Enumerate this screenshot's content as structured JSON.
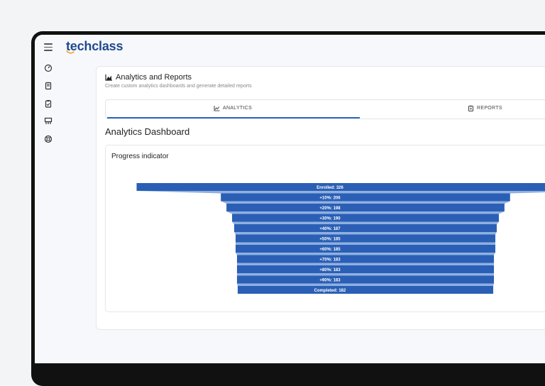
{
  "app": {
    "logo_text": "techclass"
  },
  "sidebar": {
    "icons": [
      "dashboard-icon",
      "book-icon",
      "clipboard-check-icon",
      "org-chart-icon",
      "support-icon"
    ]
  },
  "page": {
    "title": "Analytics and Reports",
    "subtitle": "Create custom analytics dashboards and generate detailed reports"
  },
  "tabs": [
    {
      "label": "ANALYTICS",
      "icon": "chart-icon",
      "active": true
    },
    {
      "label": "REPORTS",
      "icon": "clipboard-icon",
      "active": false
    }
  ],
  "section": {
    "title": "Analytics Dashboard"
  },
  "chart_title": "Progress indicator",
  "colors": {
    "bar": "#2a5fb5",
    "bar_light": "#8fb0e0",
    "accent": "#2d66c0"
  },
  "chart_data": {
    "type": "funnel",
    "title": "Progress indicator",
    "categories": [
      "Enrolled",
      "+10%",
      "+20%",
      "+30%",
      "+40%",
      "+50%",
      "+60%",
      "+70%",
      "+80%",
      "+90%",
      "Completed"
    ],
    "values": [
      326,
      206,
      198,
      190,
      187,
      185,
      185,
      183,
      183,
      183,
      182
    ],
    "labels": [
      "Enrolled: 326",
      "+10%: 206",
      "+20%: 198",
      "+30%: 190",
      "+40%: 187",
      "+50%: 185",
      "+60%: 185",
      "+70%: 183",
      "+80%: 183",
      "+90%: 183",
      "Completed: 182"
    ]
  }
}
